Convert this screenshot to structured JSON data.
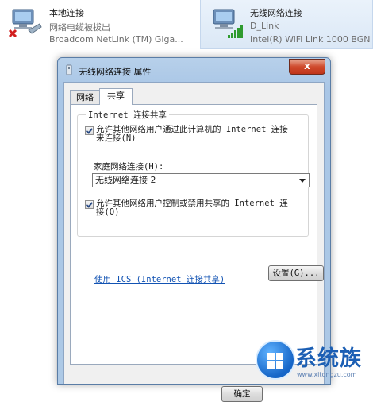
{
  "connections": {
    "local": {
      "name": "本地连接",
      "status": "网络电缆被拔出",
      "adapter": "Broadcom NetLink (TM) Giga..."
    },
    "wifi": {
      "name": "无线网络连接",
      "network": "D_Link",
      "adapter": "Intel(R) WiFi Link 1000 BGN"
    }
  },
  "dialog": {
    "title": "无线网络连接 属性",
    "close_label": "x",
    "tabs": [
      {
        "label": "网络",
        "active": false
      },
      {
        "label": "共享",
        "active": true
      }
    ],
    "group_title": "Internet 连接共享",
    "allow_share_line1": "允许其他网络用户通过此计算机的 Internet 连接",
    "allow_share_line2": "来连接(N)",
    "allow_share_checked": true,
    "home_network_label": "家庭网络连接(H):",
    "home_network_value": "无线网络连接 2",
    "allow_control_line1": "允许其他网络用户控制或禁用共享的 Internet 连",
    "allow_control_line2": "接(O)",
    "allow_control_checked": true,
    "ics_link": "使用 ICS (Internet 连接共享)",
    "settings_button": "设置(G)...",
    "ok_button": "确定"
  },
  "watermark": {
    "brand": "系统族",
    "url": "www.xitongzu.com"
  },
  "colors": {
    "accent": "#1253b3",
    "close_button": "#cf4a2c",
    "title_bar": "#b7d0ea"
  }
}
